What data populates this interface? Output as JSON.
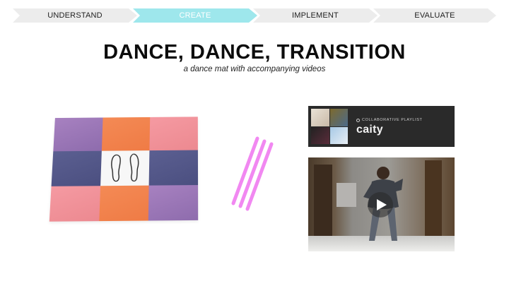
{
  "steps": [
    {
      "label": "UNDERSTAND",
      "active": false
    },
    {
      "label": "CREATE",
      "active": true
    },
    {
      "label": "IMPLEMENT",
      "active": false
    },
    {
      "label": "EVALUATE",
      "active": false
    }
  ],
  "colors": {
    "active_step": "#9ee7ec",
    "inactive_step": "#ececec",
    "stroke_accent": "#f07cf0"
  },
  "title": "DANCE, DANCE, TRANSITION",
  "subtitle": "a dance mat with accompanying videos",
  "playlist": {
    "label": "COLLABORATIVE PLAYLIST",
    "name": "caity"
  },
  "icons": {
    "playlist_label_icon": "circle-icon",
    "video_play": "play-icon",
    "mat_center": "footprints-icon"
  }
}
